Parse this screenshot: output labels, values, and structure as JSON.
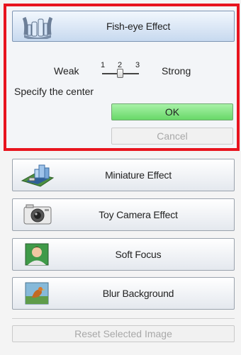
{
  "effects": [
    {
      "label": "Fish-eye Effect",
      "icon": "fish-eye-icon",
      "active": true
    },
    {
      "label": "Miniature Effect",
      "icon": "miniature-town-icon",
      "active": false
    },
    {
      "label": "Toy Camera Effect",
      "icon": "camera-icon",
      "active": false
    },
    {
      "label": "Soft Focus",
      "icon": "portrait-icon",
      "active": false
    },
    {
      "label": "Blur Background",
      "icon": "bird-icon",
      "active": false
    }
  ],
  "fisheye_panel": {
    "weak_label": "Weak",
    "strong_label": "Strong",
    "ticks": [
      "1",
      "2",
      "3"
    ],
    "selected_level": 2,
    "specify_center": "Specify the center",
    "ok_label": "OK",
    "cancel_label": "Cancel"
  },
  "reset_label": "Reset Selected Image",
  "colors": {
    "highlight_border": "#e8141e",
    "ok_green": "#68d868"
  }
}
